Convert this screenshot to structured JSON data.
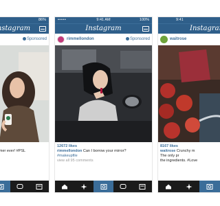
{
  "phones": [
    {
      "status": {
        "time": "",
        "battery": "86%"
      },
      "nav": {
        "title": "Instagram"
      },
      "post": {
        "username": "",
        "sponsored": "Sponsored",
        "caption_lines": [
          "warmer ever! #PSL"
        ],
        "likes": "",
        "tags": ""
      }
    },
    {
      "status": {
        "carrier": "•••••",
        "time": "9:41 AM",
        "battery": "100%"
      },
      "nav": {
        "title": "Instagram"
      },
      "post": {
        "username": "rimmellondon",
        "sponsored": "Sponsored",
        "likes": "12672 likes",
        "caption_user": "rimmellondon",
        "caption_text": "Can I borrow your mirror?",
        "tags": "#makeupfile",
        "comments": "view all 95 comments"
      }
    },
    {
      "status": {
        "time": "9:41",
        "battery": ""
      },
      "nav": {
        "title": "Instagram"
      },
      "post": {
        "username": "waitrose",
        "sponsored": "",
        "likes": "8167 likes",
        "caption_user": "waitrose",
        "caption_text": "Crunchy m",
        "caption_more": "The only pr",
        "caption_more2": "the ingredients. #Love"
      }
    }
  ],
  "colors": {
    "bar": "#2f5f8a",
    "link": "#3b6d99",
    "tabbar": "#1b1b1b"
  },
  "icons": [
    "home-icon",
    "explore-icon",
    "camera-icon",
    "activity-icon",
    "profile-icon"
  ]
}
